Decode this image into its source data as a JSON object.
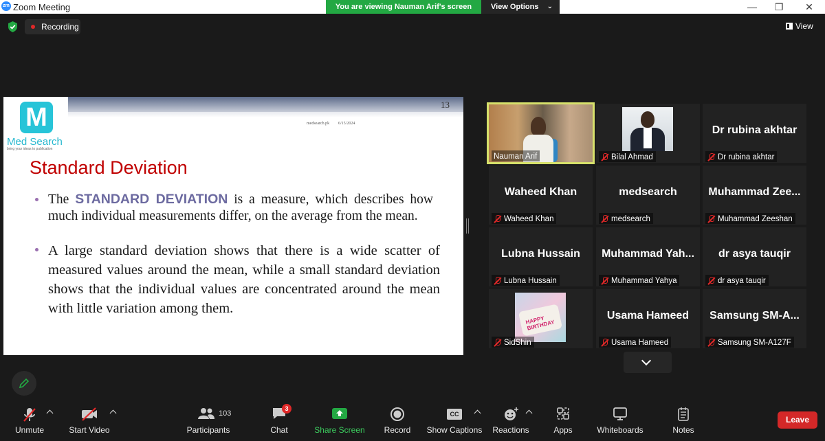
{
  "window": {
    "app_title": "Zoom Meeting",
    "app_icon_text": "zm",
    "minimize": "—",
    "maximize": "❐",
    "close": "✕"
  },
  "banner": {
    "viewing": "You are viewing Nauman Arif's screen",
    "view_options": "View Options",
    "chevron": "⌄"
  },
  "topbar": {
    "recording": "Recording",
    "view": "View"
  },
  "slide": {
    "page_number": "13",
    "site": "medsearch.pk",
    "date": "6/15/2024",
    "logo_letter": "M",
    "logo_name": "Med Search",
    "logo_tagline": "bring your ideas to publication",
    "title": "Standard Deviation",
    "bullet1": {
      "pre": "The ",
      "highlight": "STANDARD DEVIATION",
      "post": " is a measure, which describes how much individual measurements differ, on the average from the mean."
    },
    "bullet2": "A large standard deviation shows that there is a wide scatter of measured values around the mean, while a small standard deviation shows that the individual values are concentrated around the mean with little variation among them."
  },
  "participants": [
    {
      "display": "",
      "label": "Nauman Arif",
      "muted": false
    },
    {
      "display": "",
      "label": "Bilal Ahmad",
      "muted": true
    },
    {
      "display": "Dr rubina akhtar",
      "label": "Dr rubina akhtar",
      "muted": true
    },
    {
      "display": "Waheed Khan",
      "label": "Waheed Khan",
      "muted": true
    },
    {
      "display": "medsearch",
      "label": "medsearch",
      "muted": true
    },
    {
      "display": "Muhammad  Zee...",
      "label": "Muhammad Zeeshan",
      "muted": true
    },
    {
      "display": "Lubna Hussain",
      "label": "Lubna Hussain",
      "muted": true
    },
    {
      "display": "Muhammad  Yah...",
      "label": "Muhammad Yahya",
      "muted": true
    },
    {
      "display": "dr asya tauqir",
      "label": "dr asya tauqir",
      "muted": true
    },
    {
      "display": "",
      "label": "SidShin",
      "muted": true
    },
    {
      "display": "Usama Hameed",
      "label": "Usama Hameed",
      "muted": true
    },
    {
      "display": "Samsung  SM-A...",
      "label": "Samsung SM-A127F",
      "muted": true
    }
  ],
  "sid_photo_text": "HAPPY BIRTHDAY",
  "toolbar": {
    "unmute": "Unmute",
    "start_video": "Start Video",
    "participants": "Participants",
    "participants_count": "103",
    "chat": "Chat",
    "chat_badge": "3",
    "share_screen": "Share Screen",
    "record": "Record",
    "show_captions": "Show Captions",
    "cc": "CC",
    "reactions": "Reactions",
    "apps": "Apps",
    "whiteboards": "Whiteboards",
    "notes": "Notes",
    "leave": "Leave"
  },
  "colors": {
    "share_green": "#23a843",
    "leave_red": "#d42828",
    "active_speaker": "#d6e06b",
    "brand_blue": "#2d8cff"
  }
}
